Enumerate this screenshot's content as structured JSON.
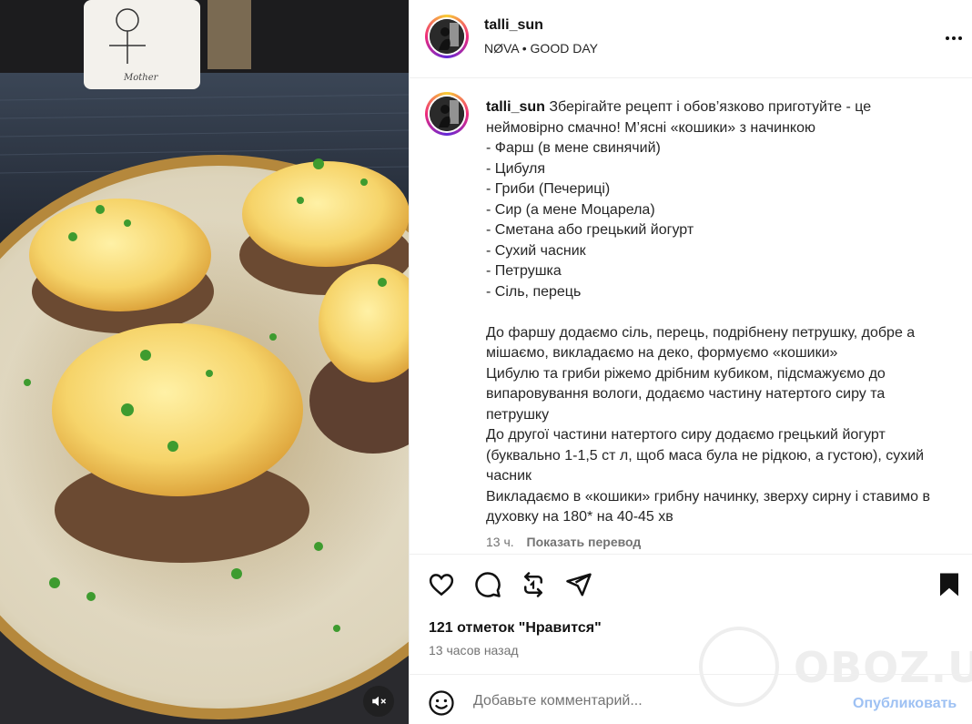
{
  "post": {
    "username": "talli_sun",
    "audio": "NØVA • GOOD DAY",
    "more_icon": "three-dots-icon",
    "caption_username": "talli_sun",
    "caption_text": " Зберігайте рецепт і обов’язково приготуйте - це неймовірно смачно! М’ясні «кошики» з начинкою\n- Фарш (в мене свинячий)\n- Цибуля\n- Гриби (Печериці)\n- Сир (а мене Моцарела)\n- Сметана або грецький йогурт\n- Сухий часник\n- Петрушка\n- Сіль, перець\n\nДо фаршу додаємо сіль, перець, подрібнену петрушку, добре а мішаємо, викладаємо на деко, формуємо «кошики»\nЦибулю та гриби ріжемо дрібним кубиком, підсмажуємо до випаровування вологи, додаємо частину натертого сиру та петрушку\nДо другої частини натертого сиру додаємо грецький йогурт (буквально 1-1,5 ст л, щоб маса була не рідкою, а густою), сухий часник\nВикладаємо в «кошики» грибну начинку, зверху сирну і ставимо в духовку на 180* на 40-45 хв",
    "time_short": "13 ч.",
    "translate_label": "Показать перевод",
    "likes": "121 отметок \"Нравится\"",
    "time_long": "13 часов назад"
  },
  "actions": {
    "like_icon": "heart-icon",
    "comment_icon": "comment-icon",
    "repost_icon": "repost-icon",
    "share_icon": "send-icon",
    "save_icon": "bookmark-icon"
  },
  "comment": {
    "placeholder": "Добавьте комментарий...",
    "post_label": "Опубликовать",
    "emoji_icon": "emoji-icon"
  },
  "media": {
    "mute_icon": "speaker-muted-icon"
  },
  "watermark": {
    "text": "OBOZ.UA"
  },
  "colors": {
    "link_disabled": "#9ec1f3",
    "secondary_text": "#737373",
    "story_ring": "#ee2a7b"
  }
}
